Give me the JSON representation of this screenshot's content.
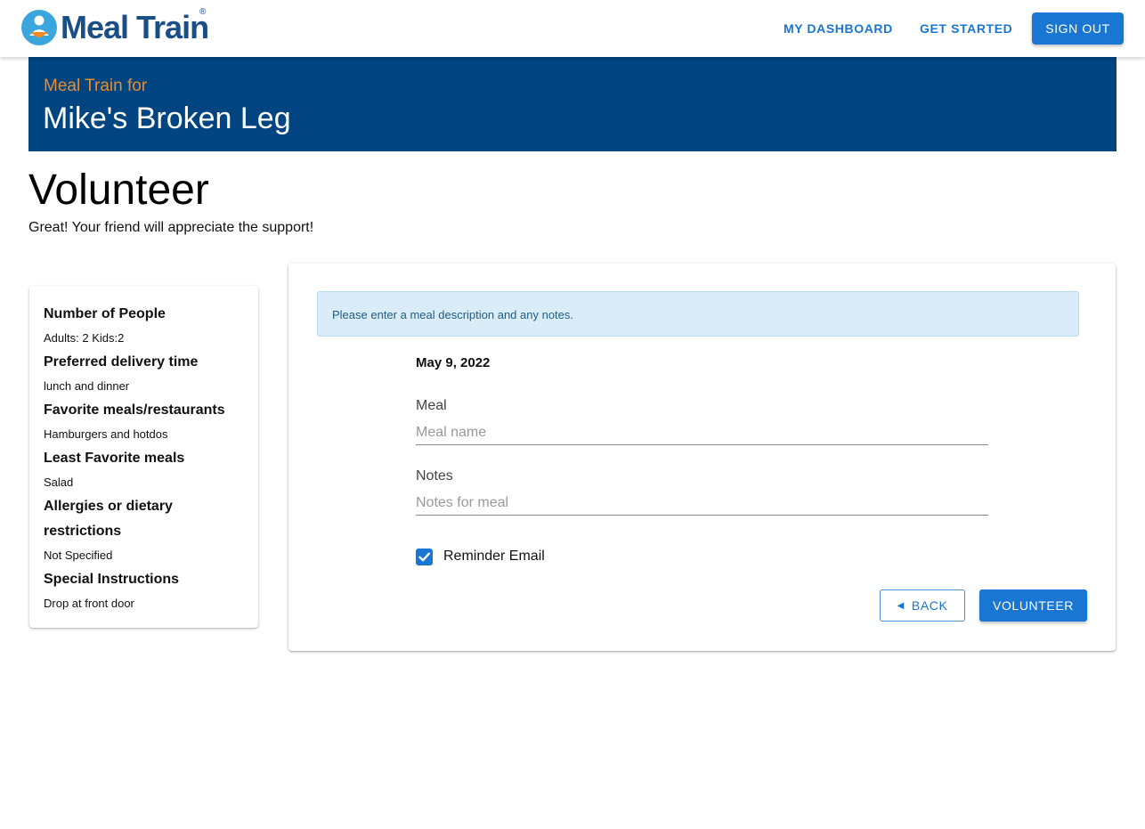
{
  "header": {
    "logo_text": "Meal Train",
    "logo_reg": "®",
    "nav": {
      "dashboard": "MY DASHBOARD",
      "get_started": "GET STARTED",
      "sign_out": "SIGN OUT"
    }
  },
  "banner": {
    "subtitle": "Meal Train for",
    "title": "Mike's Broken Leg"
  },
  "page": {
    "title": "Volunteer",
    "subtitle": "Great! Your friend will appreciate the support!"
  },
  "info": {
    "items": [
      {
        "label": "Number of People",
        "value": "Adults: 2 Kids:2"
      },
      {
        "label": "Preferred delivery time",
        "value": "lunch and dinner"
      },
      {
        "label": "Favorite meals/restaurants",
        "value": "Hamburgers and hotdos"
      },
      {
        "label": "Least Favorite meals",
        "value": "Salad"
      },
      {
        "label": "Allergies or dietary restrictions",
        "value": "Not Specified"
      },
      {
        "label": "Special Instructions",
        "value": "Drop at front door"
      }
    ]
  },
  "form": {
    "alert": "Please enter a meal description and any notes.",
    "date": "May 9, 2022",
    "meal_label": "Meal",
    "meal_placeholder": "Meal name",
    "meal_value": "",
    "notes_label": "Notes",
    "notes_placeholder": "Notes for meal",
    "notes_value": "",
    "reminder_label": "Reminder Email",
    "reminder_checked": true,
    "back_label": "BACK",
    "volunteer_label": "VOLUNTEER"
  },
  "colors": {
    "brand_blue": "#1976d2",
    "banner_navy": "#004581",
    "banner_orange": "#e88d2d",
    "alert_bg": "#d9ecf7"
  },
  "icons": {
    "logo": "meal-train-logo-icon",
    "check": "check-icon",
    "back_caret": "caret-left-icon"
  }
}
